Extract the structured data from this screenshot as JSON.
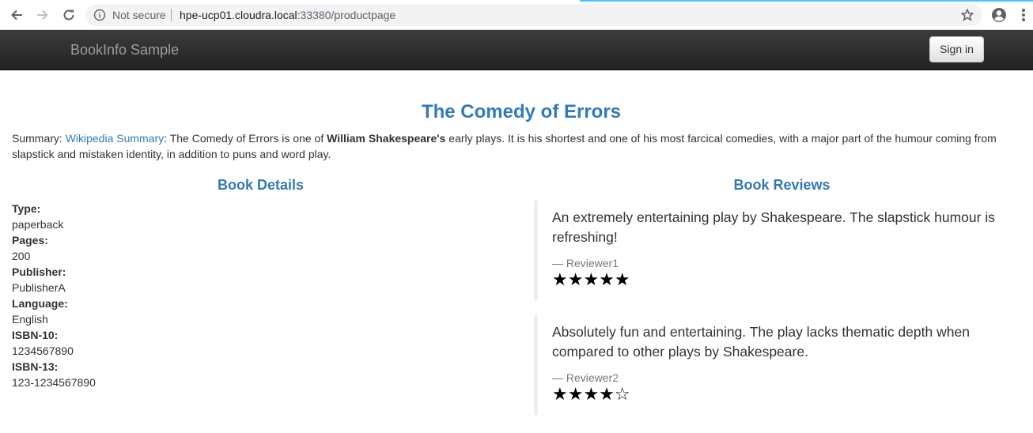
{
  "browser": {
    "security_label": "Not secure",
    "url_host": "hpe-ucp01.cloudra.local",
    "url_rest": ":33380/productpage"
  },
  "navbar": {
    "brand": "BookInfo Sample",
    "signin_label": "Sign in"
  },
  "product": {
    "title": "The Comedy of Errors",
    "summary_prefix": "Summary: ",
    "summary_link": "Wikipedia Summary",
    "summary_mid": ": The Comedy of Errors is one of ",
    "summary_bold": "William Shakespeare's",
    "summary_rest": " early plays. It is his shortest and one of his most farcical comedies, with a major part of the humour coming from slapstick and mistaken identity, in addition to puns and word play."
  },
  "details": {
    "heading": "Book Details",
    "fields": [
      {
        "label": "Type:",
        "value": "paperback"
      },
      {
        "label": "Pages:",
        "value": "200"
      },
      {
        "label": "Publisher:",
        "value": "PublisherA"
      },
      {
        "label": "Language:",
        "value": "English"
      },
      {
        "label": "ISBN-10:",
        "value": "1234567890"
      },
      {
        "label": "ISBN-13:",
        "value": "123-1234567890"
      }
    ]
  },
  "reviews": {
    "heading": "Book Reviews",
    "items": [
      {
        "text": "An extremely entertaining play by Shakespeare. The slapstick humour is refreshing!",
        "reviewer": "— Reviewer1",
        "rating": 5,
        "max_rating": 5,
        "stars": "★★★★★"
      },
      {
        "text": "Absolutely fun and entertaining. The play lacks thematic depth when compared to other plays by Shakespeare.",
        "reviewer": "— Reviewer2",
        "rating": 4,
        "max_rating": 5,
        "stars": "★★★★☆"
      }
    ]
  },
  "colors": {
    "link": "#337ab7",
    "navbar": "#222222",
    "brand": "#9d9d9d",
    "text": "#333333",
    "muted": "#777777"
  },
  "icons": {
    "back": "arrow-left-icon",
    "forward": "arrow-right-icon",
    "reload": "reload-icon",
    "info": "info-icon",
    "bookmark": "star-outline-icon",
    "profile": "account-circle-icon",
    "menu": "kebab-menu-icon"
  }
}
